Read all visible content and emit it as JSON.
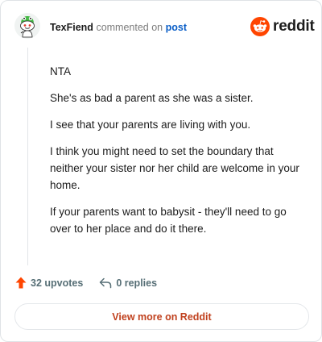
{
  "header": {
    "username": "TexFiend",
    "action": "commented on",
    "post_link": "post",
    "logo_word": "reddit"
  },
  "comment": {
    "paragraphs": [
      "NTA",
      "She's as bad a parent as she was a sister.",
      "I see that your parents are living with you.",
      "I think you might need to set the boundary that neither your sister nor her child are welcome in your home.",
      "If your parents want to babysit - they'll need to go over to her place and do it there."
    ]
  },
  "footer": {
    "upvotes": "32 upvotes",
    "replies": "0 replies",
    "view_more": "View more on Reddit"
  },
  "colors": {
    "brand": "#ff4500",
    "upvote": "#ff4500",
    "link": "#0a5ec7",
    "view_more_text": "#c0411e"
  },
  "icons": {
    "avatar": "snoo-avatar-green",
    "logo": "reddit-snoo-icon",
    "upvote": "upvote-arrow-icon",
    "reply": "reply-arrow-icon"
  }
}
